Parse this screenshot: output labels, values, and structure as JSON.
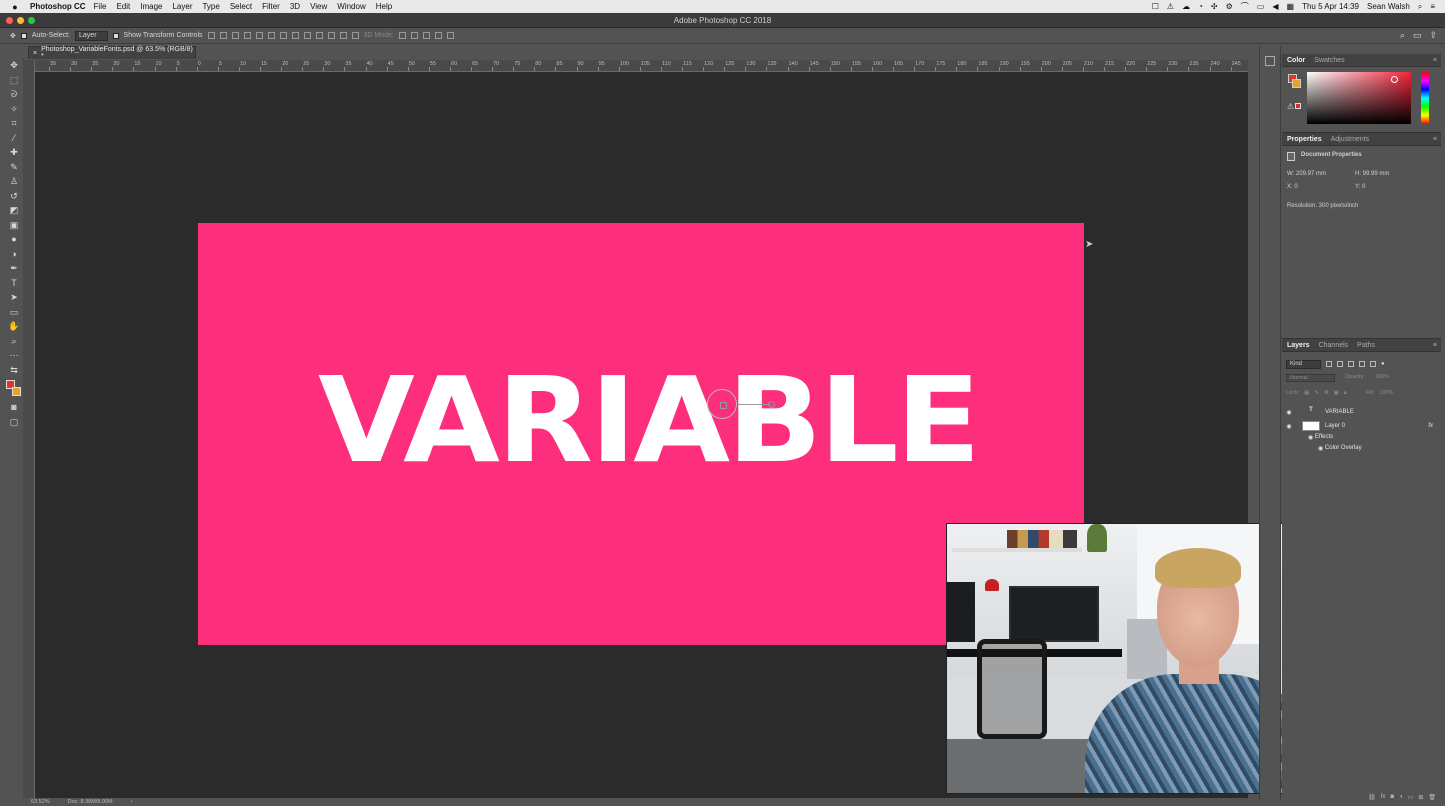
{
  "menubar": {
    "apple_icon": "apple-icon",
    "app": "Photoshop CC",
    "items": [
      "File",
      "Edit",
      "Image",
      "Layer",
      "Type",
      "Select",
      "Filter",
      "3D",
      "View",
      "Window",
      "Help"
    ],
    "clock": "Thu 5 Apr  14:39",
    "user": "Sean Walsh",
    "status_icons": [
      "☐",
      "⚠",
      "☁",
      "◔",
      "✣",
      "⚙",
      "⌒",
      "▭",
      "◀",
      "▦"
    ]
  },
  "window": {
    "title": "Adobe Photoshop CC 2018",
    "traffic_lights": {
      "close": "#fe5f57",
      "minimize": "#febc2e",
      "zoom": "#28c840"
    }
  },
  "options_bar": {
    "move_tool_icon": "move-icon",
    "auto_select_label": "Auto-Select:",
    "auto_select_value": "Layer",
    "show_transform_label": "Show Transform Controls",
    "mode_3d_label": "3D Mode:"
  },
  "document": {
    "tab_title": "Photoshop_VariableFonts.psd @ 63.5% (RGB/8) *",
    "close_glyph": "×",
    "artboard_color": "#fd2e7c",
    "text_layer": "VARIABLE"
  },
  "ruler": {
    "labels": [
      "35",
      "30",
      "25",
      "20",
      "15",
      "10",
      "5",
      "0",
      "5",
      "10",
      "15",
      "20",
      "25",
      "30",
      "35",
      "40",
      "45",
      "50",
      "55",
      "60",
      "65",
      "70",
      "75",
      "80",
      "85",
      "90",
      "95",
      "100",
      "105",
      "110",
      "115",
      "120",
      "125",
      "130",
      "135",
      "140",
      "145",
      "150",
      "155",
      "160",
      "165",
      "170",
      "175",
      "180",
      "185",
      "190",
      "195",
      "200",
      "205",
      "210",
      "215",
      "220",
      "225",
      "230",
      "235",
      "240",
      "245"
    ]
  },
  "status": {
    "zoom": "63.52%",
    "doc": "Doc: 8.38M/8.00M",
    "arrow": "›"
  },
  "panels": {
    "color_tabs": [
      "Color",
      "Swatches"
    ],
    "props_tabs": [
      "Properties",
      "Adjustments"
    ],
    "props_title": "Document Properties",
    "w": "W:  209.97 mm",
    "h": "H:  99.99 mm",
    "x": "X:  0",
    "y": "Y:  0",
    "resolution": "Resolution: 300 pixels/inch",
    "layers_tabs": [
      "Layers",
      "Channels",
      "Paths"
    ],
    "kind": "Kind",
    "blend_mode": "Normal",
    "opacity_label": "Opacity:",
    "opacity_value": "100%",
    "lock_label": "Lock:",
    "fill_label": "Fill:",
    "fill_value": "100%",
    "layers": [
      {
        "name": "VARIABLE",
        "thumb": "T"
      },
      {
        "name": "Layer 0",
        "fx": "fx"
      },
      {
        "name": "Effects"
      },
      {
        "name": "Color Overlay"
      }
    ]
  }
}
